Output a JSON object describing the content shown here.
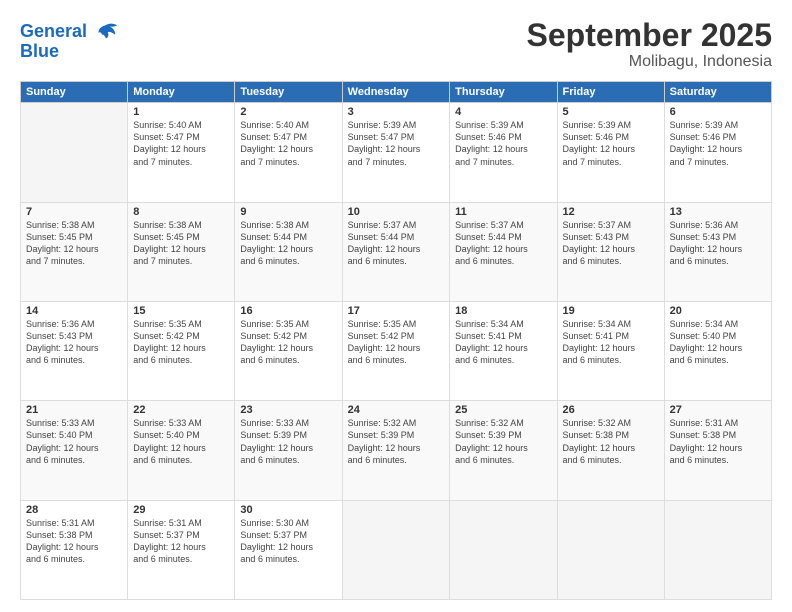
{
  "header": {
    "logo_general": "General",
    "logo_blue": "Blue",
    "month": "September 2025",
    "location": "Molibagu, Indonesia"
  },
  "days_of_week": [
    "Sunday",
    "Monday",
    "Tuesday",
    "Wednesday",
    "Thursday",
    "Friday",
    "Saturday"
  ],
  "weeks": [
    [
      {
        "day": "",
        "info": ""
      },
      {
        "day": "1",
        "info": "Sunrise: 5:40 AM\nSunset: 5:47 PM\nDaylight: 12 hours\nand 7 minutes."
      },
      {
        "day": "2",
        "info": "Sunrise: 5:40 AM\nSunset: 5:47 PM\nDaylight: 12 hours\nand 7 minutes."
      },
      {
        "day": "3",
        "info": "Sunrise: 5:39 AM\nSunset: 5:47 PM\nDaylight: 12 hours\nand 7 minutes."
      },
      {
        "day": "4",
        "info": "Sunrise: 5:39 AM\nSunset: 5:46 PM\nDaylight: 12 hours\nand 7 minutes."
      },
      {
        "day": "5",
        "info": "Sunrise: 5:39 AM\nSunset: 5:46 PM\nDaylight: 12 hours\nand 7 minutes."
      },
      {
        "day": "6",
        "info": "Sunrise: 5:39 AM\nSunset: 5:46 PM\nDaylight: 12 hours\nand 7 minutes."
      }
    ],
    [
      {
        "day": "7",
        "info": "Sunrise: 5:38 AM\nSunset: 5:45 PM\nDaylight: 12 hours\nand 7 minutes."
      },
      {
        "day": "8",
        "info": "Sunrise: 5:38 AM\nSunset: 5:45 PM\nDaylight: 12 hours\nand 7 minutes."
      },
      {
        "day": "9",
        "info": "Sunrise: 5:38 AM\nSunset: 5:44 PM\nDaylight: 12 hours\nand 6 minutes."
      },
      {
        "day": "10",
        "info": "Sunrise: 5:37 AM\nSunset: 5:44 PM\nDaylight: 12 hours\nand 6 minutes."
      },
      {
        "day": "11",
        "info": "Sunrise: 5:37 AM\nSunset: 5:44 PM\nDaylight: 12 hours\nand 6 minutes."
      },
      {
        "day": "12",
        "info": "Sunrise: 5:37 AM\nSunset: 5:43 PM\nDaylight: 12 hours\nand 6 minutes."
      },
      {
        "day": "13",
        "info": "Sunrise: 5:36 AM\nSunset: 5:43 PM\nDaylight: 12 hours\nand 6 minutes."
      }
    ],
    [
      {
        "day": "14",
        "info": "Sunrise: 5:36 AM\nSunset: 5:43 PM\nDaylight: 12 hours\nand 6 minutes."
      },
      {
        "day": "15",
        "info": "Sunrise: 5:35 AM\nSunset: 5:42 PM\nDaylight: 12 hours\nand 6 minutes."
      },
      {
        "day": "16",
        "info": "Sunrise: 5:35 AM\nSunset: 5:42 PM\nDaylight: 12 hours\nand 6 minutes."
      },
      {
        "day": "17",
        "info": "Sunrise: 5:35 AM\nSunset: 5:42 PM\nDaylight: 12 hours\nand 6 minutes."
      },
      {
        "day": "18",
        "info": "Sunrise: 5:34 AM\nSunset: 5:41 PM\nDaylight: 12 hours\nand 6 minutes."
      },
      {
        "day": "19",
        "info": "Sunrise: 5:34 AM\nSunset: 5:41 PM\nDaylight: 12 hours\nand 6 minutes."
      },
      {
        "day": "20",
        "info": "Sunrise: 5:34 AM\nSunset: 5:40 PM\nDaylight: 12 hours\nand 6 minutes."
      }
    ],
    [
      {
        "day": "21",
        "info": "Sunrise: 5:33 AM\nSunset: 5:40 PM\nDaylight: 12 hours\nand 6 minutes."
      },
      {
        "day": "22",
        "info": "Sunrise: 5:33 AM\nSunset: 5:40 PM\nDaylight: 12 hours\nand 6 minutes."
      },
      {
        "day": "23",
        "info": "Sunrise: 5:33 AM\nSunset: 5:39 PM\nDaylight: 12 hours\nand 6 minutes."
      },
      {
        "day": "24",
        "info": "Sunrise: 5:32 AM\nSunset: 5:39 PM\nDaylight: 12 hours\nand 6 minutes."
      },
      {
        "day": "25",
        "info": "Sunrise: 5:32 AM\nSunset: 5:39 PM\nDaylight: 12 hours\nand 6 minutes."
      },
      {
        "day": "26",
        "info": "Sunrise: 5:32 AM\nSunset: 5:38 PM\nDaylight: 12 hours\nand 6 minutes."
      },
      {
        "day": "27",
        "info": "Sunrise: 5:31 AM\nSunset: 5:38 PM\nDaylight: 12 hours\nand 6 minutes."
      }
    ],
    [
      {
        "day": "28",
        "info": "Sunrise: 5:31 AM\nSunset: 5:38 PM\nDaylight: 12 hours\nand 6 minutes."
      },
      {
        "day": "29",
        "info": "Sunrise: 5:31 AM\nSunset: 5:37 PM\nDaylight: 12 hours\nand 6 minutes."
      },
      {
        "day": "30",
        "info": "Sunrise: 5:30 AM\nSunset: 5:37 PM\nDaylight: 12 hours\nand 6 minutes."
      },
      {
        "day": "",
        "info": ""
      },
      {
        "day": "",
        "info": ""
      },
      {
        "day": "",
        "info": ""
      },
      {
        "day": "",
        "info": ""
      }
    ]
  ]
}
